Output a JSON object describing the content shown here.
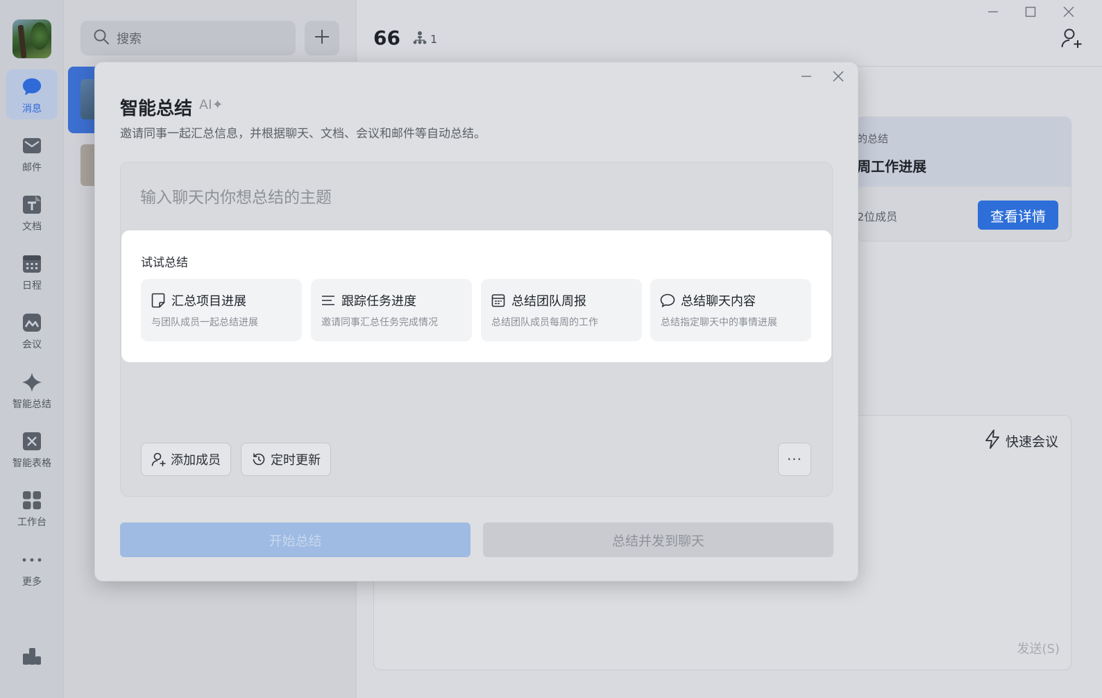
{
  "nav": {
    "items": [
      {
        "label": "消息",
        "icon": "chat-bubble-icon"
      },
      {
        "label": "邮件",
        "icon": "mail-icon"
      },
      {
        "label": "文档",
        "icon": "document-icon"
      },
      {
        "label": "日程",
        "icon": "calendar-icon"
      },
      {
        "label": "会议",
        "icon": "meeting-icon"
      },
      {
        "label": "智能总结",
        "icon": "sparkle-icon"
      },
      {
        "label": "智能表格",
        "icon": "smart-table-icon"
      },
      {
        "label": "工作台",
        "icon": "workbench-grid-icon"
      },
      {
        "label": "更多",
        "icon": "more-dots-icon"
      }
    ],
    "active_color": "#2f6ad8"
  },
  "list": {
    "search_placeholder": "搜索"
  },
  "chat": {
    "title": "66",
    "member_count": "1",
    "summary_card": {
      "label": "的总结",
      "title": "周工作进展",
      "members": "2位成员",
      "view_button": "查看详情"
    },
    "quick_meeting": "快速会议",
    "send_label": "发送(S)"
  },
  "modal": {
    "title": "智能总结",
    "badge": "AI✦",
    "subtitle": "邀请同事一起汇总信息，并根据聊天、文档、会议和邮件等自动总结。",
    "input_placeholder": "输入聊天内你想总结的主题",
    "try_label": "试试总结",
    "templates": [
      {
        "title": "汇总项目进展",
        "desc": "与团队成员一起总结进展",
        "icon": "note-icon"
      },
      {
        "title": "跟踪任务进度",
        "desc": "邀请同事汇总任务完成情况",
        "icon": "list-lines-icon"
      },
      {
        "title": "总结团队周报",
        "desc": "总结团队成员每周的工作",
        "icon": "calendar-report-icon"
      },
      {
        "title": "总结聊天内容",
        "desc": "总结指定聊天中的事情进展",
        "icon": "speech-bubble-icon"
      }
    ],
    "add_member": "添加成员",
    "schedule_update": "定时更新",
    "more": "···",
    "start_button": "开始总结",
    "send_button": "总结并发到聊天",
    "primary_color": "#9fbbe3"
  }
}
